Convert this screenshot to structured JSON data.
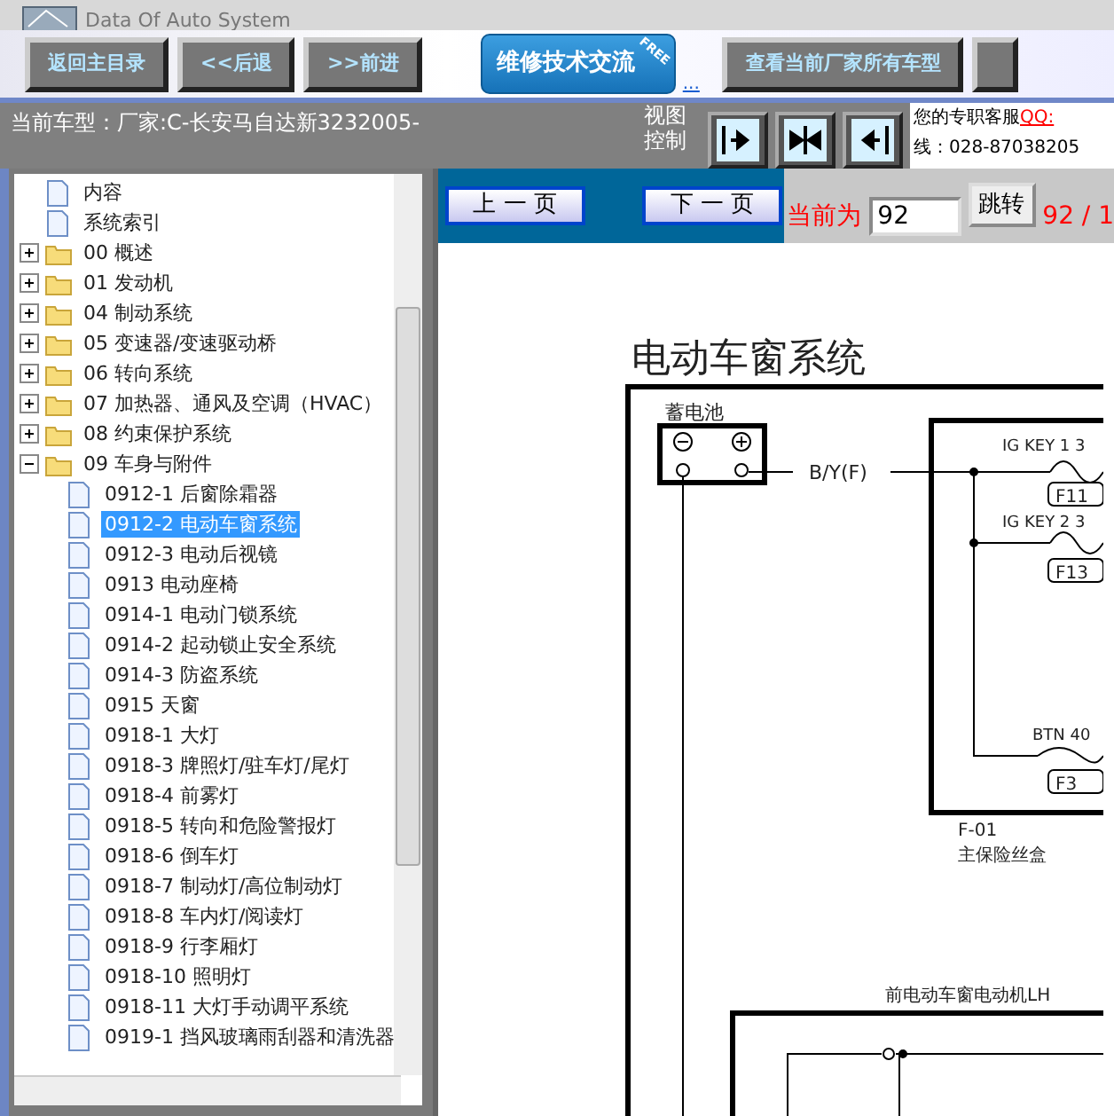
{
  "header": {
    "subtitle": "Data Of Auto System"
  },
  "toolbar": {
    "buttons": [
      {
        "label": "返回主目录"
      },
      {
        "label": "<<后退"
      },
      {
        "label": ">>前进"
      }
    ],
    "promo": {
      "label": "维修技术交流",
      "badge": "FREE",
      "link": "..."
    },
    "models_button": "查看当前厂家所有车型"
  },
  "info_bar": {
    "current_model": "当前车型：厂家:C-长安马自达新3232005-",
    "view_control": "视图控制",
    "service": {
      "text": "您的专职客服",
      "qq": "QQ:",
      "phone": "线：028-87038205"
    }
  },
  "tree": {
    "items": [
      {
        "label": "内容",
        "kind": "doc",
        "selected": false
      },
      {
        "label": "系统索引",
        "kind": "doc",
        "selected": false
      },
      {
        "label": "00 概述",
        "kind": "folder",
        "expanded": false,
        "selected": false
      },
      {
        "label": "01 发动机",
        "kind": "folder",
        "expanded": false,
        "selected": false
      },
      {
        "label": "04 制动系统",
        "kind": "folder",
        "expanded": false,
        "selected": false
      },
      {
        "label": "05 变速器/变速驱动桥",
        "kind": "folder",
        "expanded": false,
        "selected": false
      },
      {
        "label": "06 转向系统",
        "kind": "folder",
        "expanded": false,
        "selected": false
      },
      {
        "label": "07 加热器、通风及空调（HVAC）",
        "kind": "folder",
        "expanded": false,
        "selected": false
      },
      {
        "label": "08 约束保护系统",
        "kind": "folder",
        "expanded": false,
        "selected": false
      },
      {
        "label": "09 车身与附件",
        "kind": "folder",
        "expanded": true,
        "selected": false,
        "children": [
          {
            "label": "0912-1 后窗除霜器",
            "kind": "doc",
            "selected": false
          },
          {
            "label": "0912-2 电动车窗系统",
            "kind": "doc",
            "selected": true
          },
          {
            "label": "0912-3 电动后视镜",
            "kind": "doc",
            "selected": false
          },
          {
            "label": "0913 电动座椅",
            "kind": "doc",
            "selected": false
          },
          {
            "label": "0914-1 电动门锁系统",
            "kind": "doc",
            "selected": false
          },
          {
            "label": "0914-2 起动锁止安全系统",
            "kind": "doc",
            "selected": false
          },
          {
            "label": "0914-3 防盗系统",
            "kind": "doc",
            "selected": false
          },
          {
            "label": "0915 天窗",
            "kind": "doc",
            "selected": false
          },
          {
            "label": "0918-1 大灯",
            "kind": "doc",
            "selected": false
          },
          {
            "label": "0918-3 牌照灯/驻车灯/尾灯",
            "kind": "doc",
            "selected": false
          },
          {
            "label": "0918-4 前雾灯",
            "kind": "doc",
            "selected": false
          },
          {
            "label": "0918-5 转向和危险警报灯",
            "kind": "doc",
            "selected": false
          },
          {
            "label": "0918-6 倒车灯",
            "kind": "doc",
            "selected": false
          },
          {
            "label": "0918-7 制动灯/高位制动灯",
            "kind": "doc",
            "selected": false
          },
          {
            "label": "0918-8 车内灯/阅读灯",
            "kind": "doc",
            "selected": false
          },
          {
            "label": "0918-9 行李厢灯",
            "kind": "doc",
            "selected": false
          },
          {
            "label": "0918-10 照明灯",
            "kind": "doc",
            "selected": false
          },
          {
            "label": "0918-11 大灯手动调平系统",
            "kind": "doc",
            "selected": false
          },
          {
            "label": "0919-1 挡风玻璃雨刮器和清洗器",
            "kind": "doc",
            "selected": false
          }
        ]
      }
    ]
  },
  "pager": {
    "prev": "上 一 页",
    "next": "下 一 页",
    "current_label": "当前为",
    "page_value": "92",
    "jump": "跳转",
    "page_count": "92 / 1"
  },
  "document": {
    "title": "电动车窗系统",
    "battery": "蓄电池",
    "wire": "B/Y(F)",
    "fuses": [
      {
        "name": "IG KEY 1 3",
        "label": "F11"
      },
      {
        "name": "IG KEY 2 3",
        "label": "F13"
      },
      {
        "name": "BTN 40",
        "label": "F3"
      }
    ],
    "fuse_box": {
      "id": "F-01",
      "name": "主保险丝盒"
    },
    "motor": "前电动车窗电动机LH"
  }
}
